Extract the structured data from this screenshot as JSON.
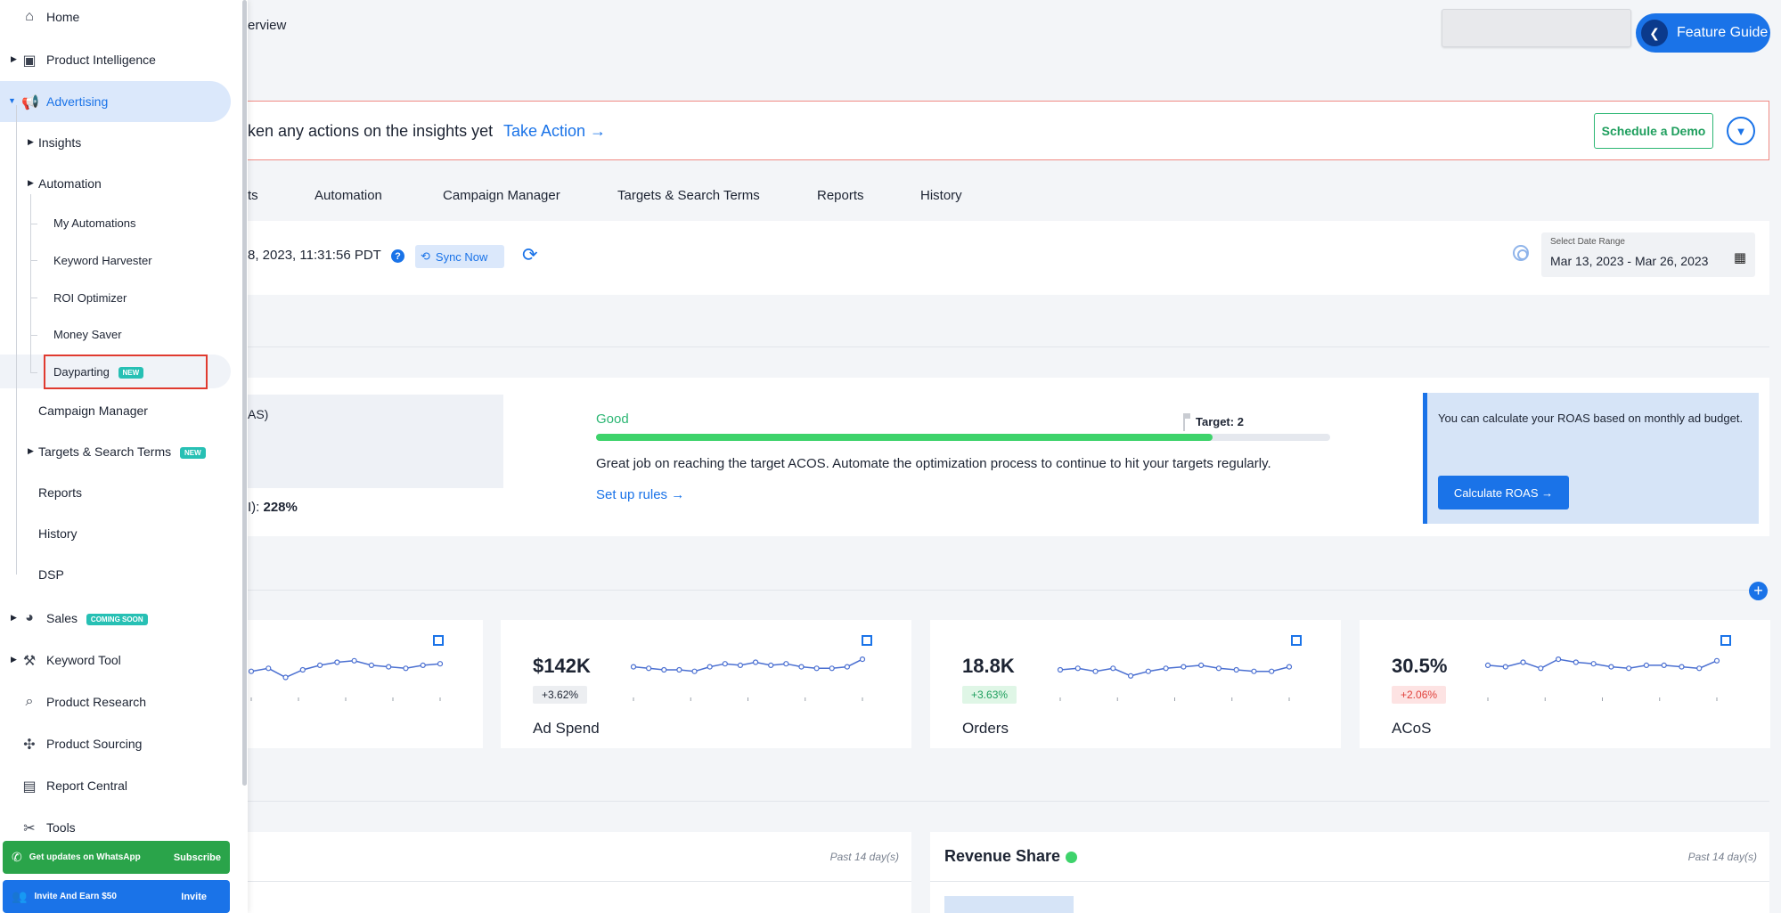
{
  "header": {
    "title_fragment": "erview",
    "feature_guide_label": "Feature Guide"
  },
  "alert": {
    "text": "ken any actions on the insights yet",
    "action": "Take Action →",
    "demo_button": "Schedule a Demo"
  },
  "tabs": [
    {
      "label": "ts"
    },
    {
      "label": "Automation"
    },
    {
      "label": "Campaign Manager"
    },
    {
      "label": "Targets & Search Terms"
    },
    {
      "label": "Reports"
    },
    {
      "label": "History"
    }
  ],
  "sync": {
    "time_text": "8, 2023, 11:31:56 PDT",
    "button_label": "Sync Now",
    "date_range_label": "Select Date Range",
    "date_range_value": "Mar 13, 2023 - Mar 26, 2023"
  },
  "roas": {
    "left_title_fragment": "AS)",
    "current_prefix": "I): ",
    "current_value": "228%",
    "status": "Good",
    "progress_fraction": 0.84,
    "target_label": "Target: 2",
    "message": "Great job on reaching the target ACOS. Automate the optimization process to continue to hit your targets regularly.",
    "setup_link": "Set up rules →",
    "calc_text": "You can calculate your ROAS based on monthly ad budget.",
    "calc_button": "Calculate ROAS  →"
  },
  "metrics": [
    {
      "value": "",
      "change": "",
      "label": "",
      "change_type": "neutral",
      "trend": [
        0.55,
        0.45,
        0.75,
        0.5,
        0.35,
        0.25,
        0.2,
        0.35,
        0.4,
        0.45,
        0.35,
        0.3
      ]
    },
    {
      "value": "$142K",
      "change": "+3.62%",
      "label": "Ad Spend",
      "change_type": "neutral",
      "trend": [
        0.4,
        0.45,
        0.5,
        0.5,
        0.55,
        0.4,
        0.3,
        0.35,
        0.25,
        0.35,
        0.3,
        0.4,
        0.45,
        0.45,
        0.4,
        0.15
      ]
    },
    {
      "value": "18.8K",
      "change": "+3.63%",
      "label": "Orders",
      "change_type": "up",
      "trend": [
        0.5,
        0.45,
        0.55,
        0.45,
        0.7,
        0.55,
        0.45,
        0.4,
        0.35,
        0.45,
        0.5,
        0.55,
        0.55,
        0.4
      ]
    },
    {
      "value": "30.5%",
      "change": "+2.06%",
      "label": "ACoS",
      "change_type": "down",
      "trend": [
        0.35,
        0.4,
        0.25,
        0.45,
        0.15,
        0.25,
        0.3,
        0.4,
        0.45,
        0.35,
        0.35,
        0.4,
        0.45,
        0.2
      ]
    }
  ],
  "bottom": {
    "left_period": "Past 14 day(s)",
    "right_title": "Revenue Share",
    "right_period": "Past 14 day(s)"
  },
  "sidebar": {
    "items": [
      {
        "label": "Home",
        "icon": "home-icon"
      },
      {
        "label": "Product Intelligence",
        "icon": "archive-icon"
      },
      {
        "label": "Advertising",
        "icon": "megaphone-icon"
      },
      {
        "label": "Insights"
      },
      {
        "label": "Automation"
      },
      {
        "label": "My Automations"
      },
      {
        "label": "Keyword Harvester"
      },
      {
        "label": "ROI Optimizer"
      },
      {
        "label": "Money Saver"
      },
      {
        "label": "Dayparting",
        "badge": "NEW"
      },
      {
        "label": "Campaign Manager"
      },
      {
        "label": "Targets & Search Terms",
        "badge": "NEW"
      },
      {
        "label": "Reports"
      },
      {
        "label": "History"
      },
      {
        "label": "DSP"
      },
      {
        "label": "Sales",
        "icon": "pie-chart-icon",
        "badge": "COMING SOON"
      },
      {
        "label": "Keyword Tool",
        "icon": "wrench-icon"
      },
      {
        "label": "Product Research",
        "icon": "search-icon"
      },
      {
        "label": "Product Sourcing",
        "icon": "sourcing-icon"
      },
      {
        "label": "Report Central",
        "icon": "document-icon"
      },
      {
        "label": "Tools",
        "icon": "tools-icon"
      }
    ],
    "whatsapp": {
      "text": "Get updates on WhatsApp",
      "action": "Subscribe"
    },
    "invite": {
      "text": "Invite And Earn $50",
      "action": "Invite"
    }
  },
  "colors": {
    "accent": "#1a73e8",
    "success": "#2bb673",
    "danger": "#e03a2f",
    "whatsapp": "#2aa44a"
  }
}
